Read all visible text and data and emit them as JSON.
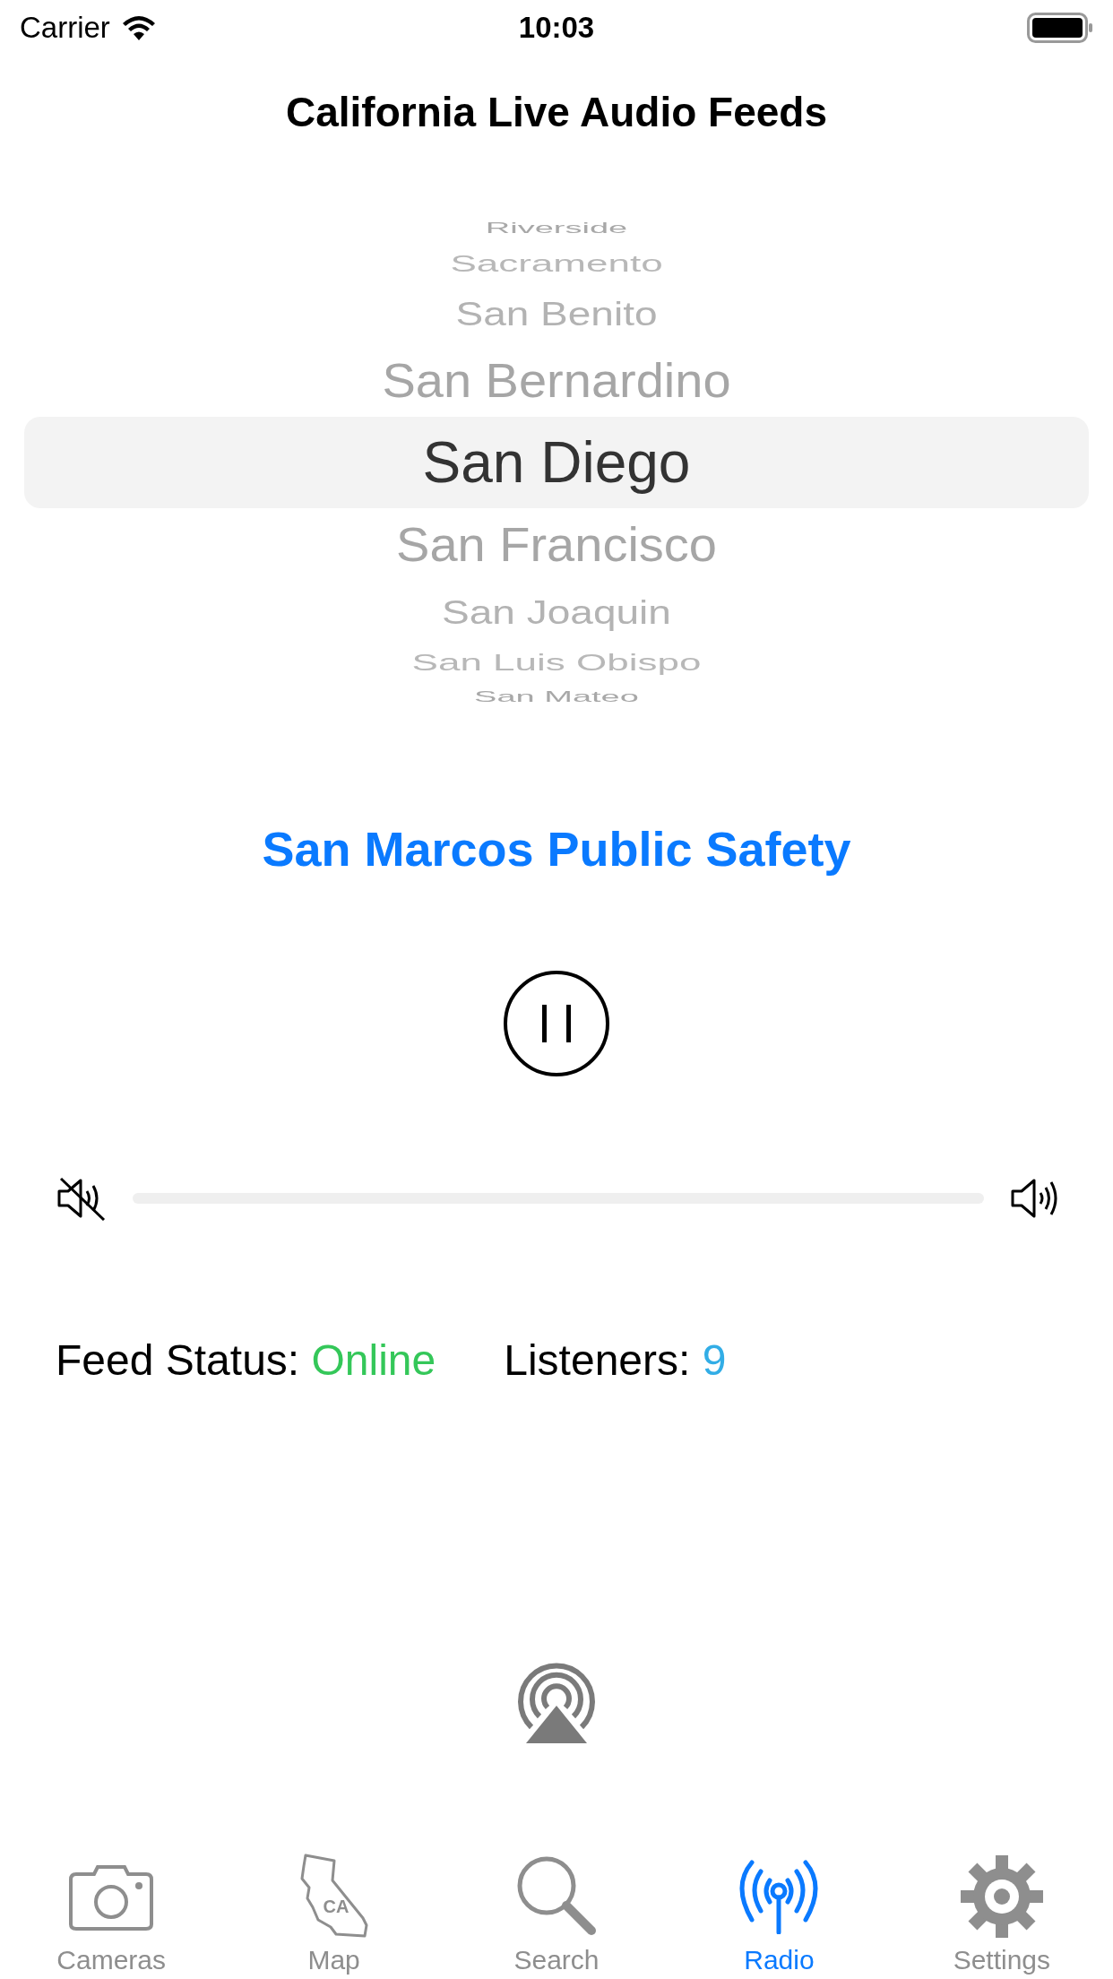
{
  "status_bar": {
    "carrier": "Carrier",
    "time": "10:03"
  },
  "title": "California Live Audio Feeds",
  "picker": {
    "items": [
      {
        "label": "Riverside",
        "selected": false
      },
      {
        "label": "Sacramento",
        "selected": false
      },
      {
        "label": "San Benito",
        "selected": false
      },
      {
        "label": "San Bernardino",
        "selected": false
      },
      {
        "label": "San Diego",
        "selected": true
      },
      {
        "label": "San Francisco",
        "selected": false
      },
      {
        "label": "San Joaquin",
        "selected": false
      },
      {
        "label": "San Luis Obispo",
        "selected": false
      },
      {
        "label": "San Mateo",
        "selected": false
      }
    ]
  },
  "feed_name": "San Marcos Public Safety",
  "player": {
    "playing": true,
    "volume": {
      "level": 0
    }
  },
  "feed_status": {
    "label": "Feed Status:",
    "value": "Online",
    "listeners_label": "Listeners:",
    "listeners": "9"
  },
  "tabs": [
    {
      "kind": "camera",
      "label": "Cameras",
      "selected": false
    },
    {
      "kind": "map",
      "label": "Map",
      "badge": "CA",
      "selected": false
    },
    {
      "kind": "search",
      "label": "Search",
      "selected": false
    },
    {
      "kind": "radio",
      "label": "Radio",
      "selected": true
    },
    {
      "kind": "settings",
      "label": "Settings",
      "selected": false
    }
  ]
}
